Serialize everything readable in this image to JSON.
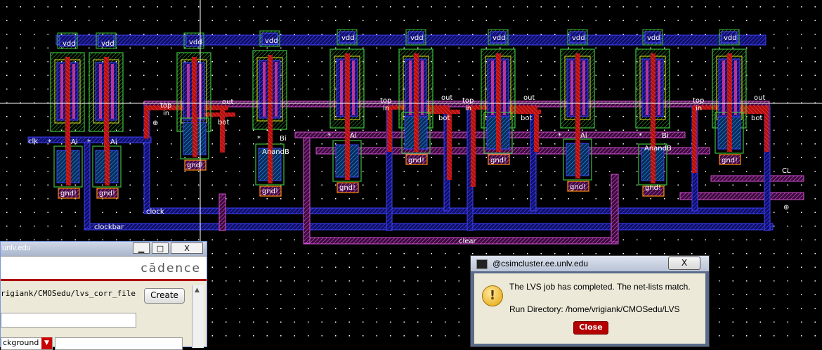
{
  "layout_view": {
    "vdd_label": "vdd",
    "gnd_label": "gnd!",
    "net_labels": {
      "clk": "clk",
      "clock": "clock",
      "clockbar": "clockbar",
      "clear": "clear",
      "top": "top",
      "in": "in",
      "out": "out",
      "bot": "bot",
      "ai": "Ai",
      "bi": "Bi",
      "star": "*",
      "anandb": "AnandB",
      "cl": "CL"
    }
  },
  "lvs_form": {
    "title_fragment": "unlv.edu",
    "brand": "cādence",
    "path_value": "rigiank/CMOSedu/lvs_corr_file",
    "create_button": "Create",
    "select_value": "ckground",
    "min_label": "▁",
    "max_label": "□",
    "close_label": "X"
  },
  "lvs_dialog": {
    "title": "@csimcluster.ee.unlv.edu",
    "close_x": "X",
    "message_line1": "The LVS job has completed. The net-lists match.",
    "message_line2": "Run Directory: /home/vrigiank/CMOSedu/LVS",
    "close_button": "Close"
  },
  "colors": {
    "background": "#000000",
    "metal1": "#2020e0",
    "poly": "#e02020",
    "nwell": "#40c040",
    "pselect": "#c040c0",
    "gnd_box": "#ff8a00"
  }
}
